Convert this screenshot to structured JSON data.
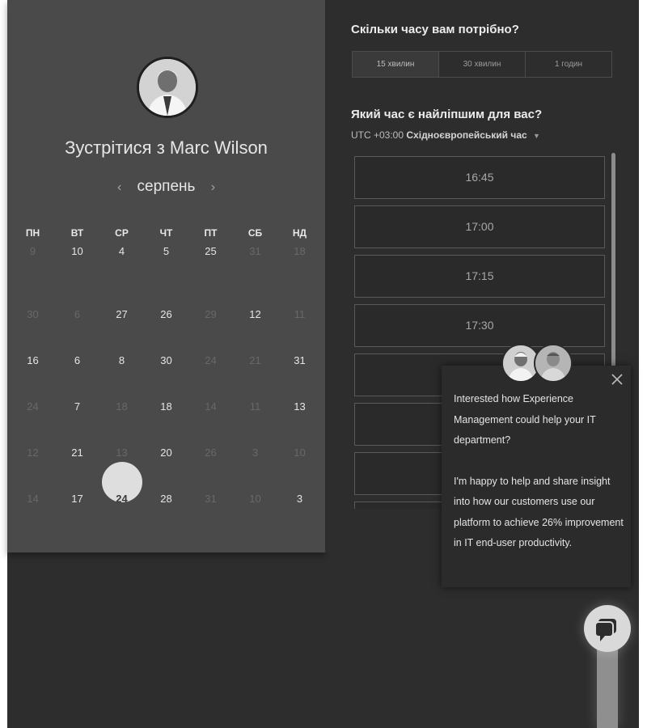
{
  "left": {
    "meet_prefix": "Зустрітися з",
    "host_name": "Marc Wilson",
    "month": "серпень",
    "prev_arrow": "‹",
    "next_arrow": "›",
    "weekdays": [
      "ПН",
      "ВТ",
      "СР",
      "ЧТ",
      "ПТ",
      "СБ",
      "НД"
    ],
    "weeks": [
      [
        {
          "d": "9",
          "dim": true
        },
        {
          "d": "10"
        },
        {
          "d": "4"
        },
        {
          "d": "5"
        },
        {
          "d": "25"
        },
        {
          "d": "31",
          "dim": true
        },
        {
          "d": "18",
          "dim": true
        }
      ],
      [
        {
          "d": "30",
          "dim": true
        },
        {
          "d": "6",
          "dim": true
        },
        {
          "d": "27"
        },
        {
          "d": "26"
        },
        {
          "d": "29",
          "dim": true
        },
        {
          "d": "12"
        },
        {
          "d": "11",
          "dim": true
        }
      ],
      [
        {
          "d": "16"
        },
        {
          "d": "6"
        },
        {
          "d": "8"
        },
        {
          "d": "30"
        },
        {
          "d": "24",
          "dim": true
        },
        {
          "d": "21",
          "dim": true
        },
        {
          "d": "31"
        }
      ],
      [
        {
          "d": "24",
          "dim": true
        },
        {
          "d": "7"
        },
        {
          "d": "18",
          "dim": true
        },
        {
          "d": "18"
        },
        {
          "d": "14",
          "dim": true
        },
        {
          "d": "11",
          "dim": true
        },
        {
          "d": "13"
        }
      ],
      [
        {
          "d": "12",
          "dim": true
        },
        {
          "d": "21"
        },
        {
          "d": "13",
          "dim": true
        },
        {
          "d": "20"
        },
        {
          "d": "26",
          "dim": true
        },
        {
          "d": "3",
          "dim": true
        },
        {
          "d": "10",
          "dim": true
        }
      ],
      [
        {
          "d": "14",
          "dim": true
        },
        {
          "d": "17"
        },
        {
          "d": "24",
          "selected": true
        },
        {
          "d": "28"
        },
        {
          "d": "31",
          "dim": true
        },
        {
          "d": "10",
          "dim": true
        },
        {
          "d": "3"
        }
      ]
    ]
  },
  "right": {
    "duration_question": "Скільки часу вам потрібно?",
    "durations": [
      "15 хвилин",
      "30 хвилин",
      "1 годин"
    ],
    "time_question": "Який час є найліпшим для вас?",
    "tz_offset": "UTC +03:00",
    "tz_name": "Східноєвропейський час",
    "slots": [
      "16:45",
      "17:00",
      "17:15",
      "17:30",
      "",
      "",
      "",
      ""
    ]
  },
  "popup": {
    "line1": "Interested how Experience Management could help your IT department?",
    "line2": "I'm happy to help and share insight into how our customers use our platform to achieve 26% improvement in IT end-user productivity."
  },
  "icons": {
    "close": "close-icon",
    "chat": "chat-bubble-icon",
    "avatar": "person-avatar"
  }
}
